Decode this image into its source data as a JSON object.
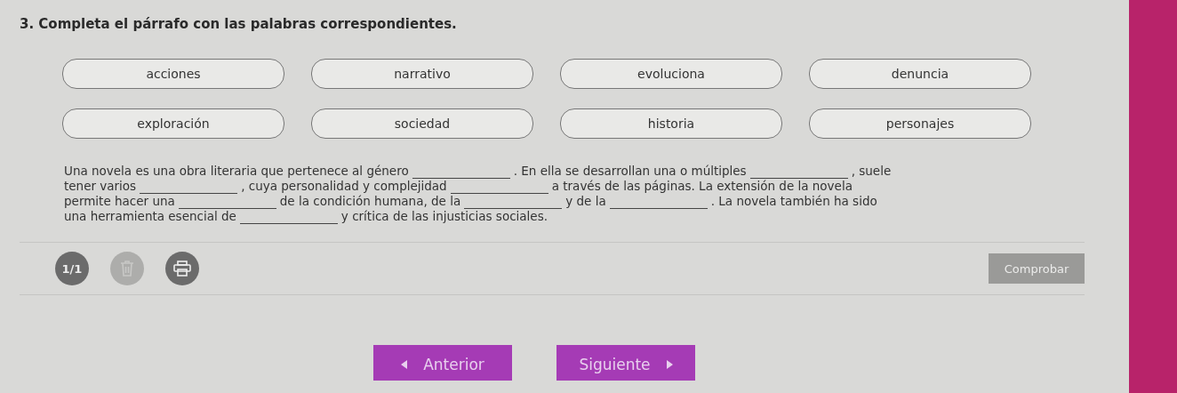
{
  "question": {
    "title": "3. Completa el párrafo con las palabras correspondientes."
  },
  "word_bank": [
    "acciones",
    "narrativo",
    "evoluciona",
    "denuncia",
    "exploración",
    "sociedad",
    "historia",
    "personajes"
  ],
  "paragraph": [
    [
      {
        "kind": "text",
        "text": "Una novela es una obra literaria que pertenece al género"
      },
      {
        "kind": "blank"
      },
      {
        "kind": "text",
        "text": ". En ella se desarrollan una o múltiples"
      },
      {
        "kind": "blank"
      },
      {
        "kind": "text",
        "text": ", suele"
      }
    ],
    [
      {
        "kind": "text",
        "text": "tener varios"
      },
      {
        "kind": "blank"
      },
      {
        "kind": "text",
        "text": ", cuya personalidad y complejidad"
      },
      {
        "kind": "blank"
      },
      {
        "kind": "text",
        "text": "a través de las páginas. La extensión de la novela"
      }
    ],
    [
      {
        "kind": "text",
        "text": "permite hacer una"
      },
      {
        "kind": "blank"
      },
      {
        "kind": "text",
        "text": "de la condición humana, de la"
      },
      {
        "kind": "blank"
      },
      {
        "kind": "text",
        "text": "y de la"
      },
      {
        "kind": "blank"
      },
      {
        "kind": "text",
        "text": ". La novela también ha sido"
      }
    ],
    [
      {
        "kind": "text",
        "text": "una herramienta esencial de"
      },
      {
        "kind": "blank"
      },
      {
        "kind": "text",
        "text": "y crítica de las injusticias sociales."
      }
    ]
  ],
  "toolbar": {
    "counter": "1/1",
    "delete_disabled": true,
    "print_disabled": false,
    "check_button": {
      "label": "Comprobar",
      "disabled": true
    }
  },
  "navigation": [
    {
      "label": "Anterior",
      "kind": "previous"
    },
    {
      "label": "Siguiente",
      "kind": "next"
    }
  ]
}
